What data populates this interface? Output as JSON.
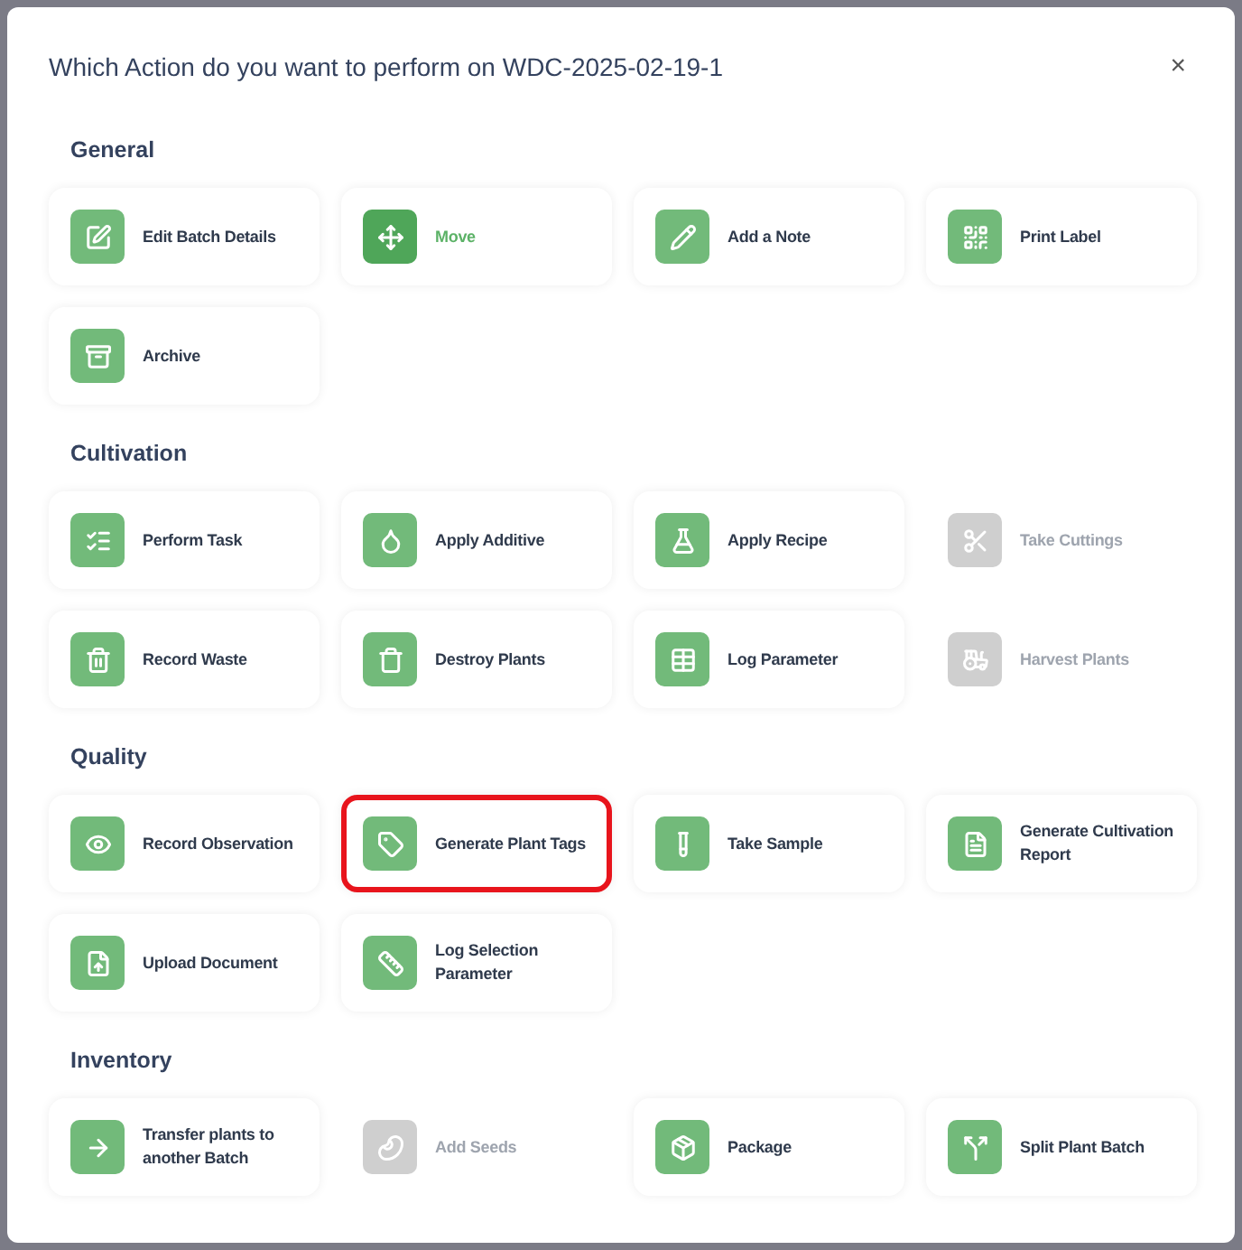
{
  "dialog": {
    "title": "Which Action do you want to perform on WDC-2025-02-19-1",
    "close": "×"
  },
  "sections": [
    {
      "heading": "General",
      "actions": [
        {
          "label": "Edit Batch Details",
          "disabled": false,
          "hovered": false,
          "highlighted": false
        },
        {
          "label": "Move",
          "disabled": false,
          "hovered": true,
          "highlighted": false
        },
        {
          "label": "Add a Note",
          "disabled": false,
          "hovered": false,
          "highlighted": false
        },
        {
          "label": "Print Label",
          "disabled": false,
          "hovered": false,
          "highlighted": false
        },
        {
          "label": "Archive",
          "disabled": false,
          "hovered": false,
          "highlighted": false
        }
      ]
    },
    {
      "heading": "Cultivation",
      "actions": [
        {
          "label": "Perform Task",
          "disabled": false,
          "hovered": false,
          "highlighted": false
        },
        {
          "label": "Apply Additive",
          "disabled": false,
          "hovered": false,
          "highlighted": false
        },
        {
          "label": "Apply Recipe",
          "disabled": false,
          "hovered": false,
          "highlighted": false
        },
        {
          "label": "Take Cuttings",
          "disabled": true,
          "hovered": false,
          "highlighted": false
        },
        {
          "label": "Record Waste",
          "disabled": false,
          "hovered": false,
          "highlighted": false
        },
        {
          "label": "Destroy Plants",
          "disabled": false,
          "hovered": false,
          "highlighted": false
        },
        {
          "label": "Log Parameter",
          "disabled": false,
          "hovered": false,
          "highlighted": false
        },
        {
          "label": "Harvest Plants",
          "disabled": true,
          "hovered": false,
          "highlighted": false
        }
      ]
    },
    {
      "heading": "Quality",
      "actions": [
        {
          "label": "Record Observation",
          "disabled": false,
          "hovered": false,
          "highlighted": false
        },
        {
          "label": "Generate Plant Tags",
          "disabled": false,
          "hovered": false,
          "highlighted": true
        },
        {
          "label": "Take Sample",
          "disabled": false,
          "hovered": false,
          "highlighted": false
        },
        {
          "label": "Generate Cultivation Report",
          "disabled": false,
          "hovered": false,
          "highlighted": false
        },
        {
          "label": "Upload Document",
          "disabled": false,
          "hovered": false,
          "highlighted": false
        },
        {
          "label": "Log Selection Parameter",
          "disabled": false,
          "hovered": false,
          "highlighted": false
        }
      ]
    },
    {
      "heading": "Inventory",
      "actions": [
        {
          "label": "Transfer plants to another Batch",
          "disabled": false,
          "hovered": false,
          "highlighted": false
        },
        {
          "label": "Add Seeds",
          "disabled": true,
          "hovered": false,
          "highlighted": false
        },
        {
          "label": "Package",
          "disabled": false,
          "hovered": false,
          "highlighted": false
        },
        {
          "label": "Split Plant Batch",
          "disabled": false,
          "hovered": false,
          "highlighted": false
        }
      ]
    }
  ]
}
